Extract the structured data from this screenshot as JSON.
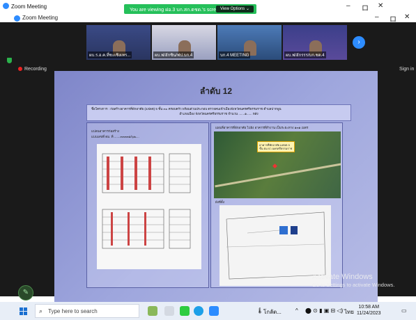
{
  "outer_window": {
    "title": "Zoom Meeting"
  },
  "share_banner": {
    "message": "You are viewing ฝอ.3 บก.สก.ตชด.'s screen",
    "view_options_label": "View Options"
  },
  "inner_window": {
    "title": "Zoom Meeting"
  },
  "window_controls": {
    "minimize": "–",
    "maximize": "ロ",
    "close": "✕"
  },
  "thumbnails": [
    {
      "label": "ผบ.ร.อ.ค.ที่ชะเชิงเทร..."
    },
    {
      "label": "ผบ.ฟ/ฮักซิน/ฟป.บก.4"
    },
    {
      "label": "บก.4 MEETING"
    },
    {
      "label": "ผบ.ฟ/ฮักรรร/บก.ชด.4"
    }
  ],
  "next_button": "›",
  "recording_label": "Recording",
  "signin_label": "Sign in",
  "slide": {
    "title": "ลำดับ 12",
    "project_line1": "ชื่อโครงการ : ก่อสร้างอาคารที่พักอาศัย (แฟลต) 5 ชั้น ๓๐ ครอบครัว พร้อมส่วนประกอบ ตรวจคนเข้าเมืองจังหวัดนครศรีธรรมราช ตำบลปากพูน",
    "project_line2": "อำเภอเมือง จังหวัดนครศรีธรรมราช จำนวน .......๑...... หลัง",
    "left_caption1": "แปลนอาคารก่อสร้าง",
    "left_caption2": "แบบเลขที่ ตม. ที่ .......๓๓๓๓๑/๖๒....",
    "right_caption": "แผนที่อาคารที่พักอาศัย ไปยัง อาคารที่ทำงาน เป็นระยะทาง ๑๓๑ เมตร",
    "map_callout": "อาคารที่พักอาศัย แฟลต 5 ชั้น ตม.จว.นครศรีธรรมราช",
    "site_caption": "ผังที่ตั้ง"
  },
  "activate_windows": {
    "title": "Activate Windows",
    "subtitle": "Go to Settings to activate Windows."
  },
  "taskbar": {
    "search_placeholder": "Type here to search",
    "tray_label": "โกลัต...",
    "language": "ไทย",
    "time": "10:58 AM",
    "date": "11/24/2023"
  },
  "colors": {
    "zoom_blue": "#2D8CFF",
    "share_green": "#25c05a",
    "slide_bg": "#9ea6dd"
  }
}
